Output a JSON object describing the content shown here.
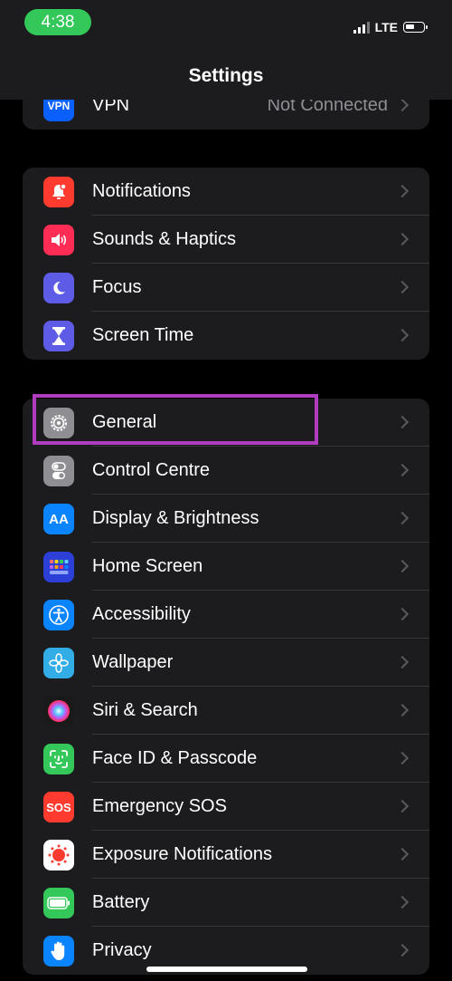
{
  "status_bar": {
    "time": "4:38",
    "network": "LTE"
  },
  "title": "Settings",
  "vpn": {
    "label": "VPN",
    "icon_text": "VPN",
    "value": "Not Connected",
    "icon_color": "#0a60ff"
  },
  "group1": [
    {
      "label": "Notifications",
      "icon": "notifications-icon",
      "color": "#ff3b30"
    },
    {
      "label": "Sounds & Haptics",
      "icon": "speaker-icon",
      "color": "#ff2d55"
    },
    {
      "label": "Focus",
      "icon": "moon-icon",
      "color": "#5e5ce6"
    },
    {
      "label": "Screen Time",
      "icon": "hourglass-icon",
      "color": "#5e5ce6"
    }
  ],
  "group2": [
    {
      "label": "General",
      "icon": "gear-icon",
      "color": "#8e8e93"
    },
    {
      "label": "Control Centre",
      "icon": "toggles-icon",
      "color": "#8e8e93"
    },
    {
      "label": "Display & Brightness",
      "icon": "text-size-icon",
      "icon_text": "AA",
      "color": "#0a84ff"
    },
    {
      "label": "Home Screen",
      "icon": "app-grid-icon",
      "color": "#2c3fd6"
    },
    {
      "label": "Accessibility",
      "icon": "accessibility-icon",
      "color": "#0a84ff"
    },
    {
      "label": "Wallpaper",
      "icon": "flower-icon",
      "color": "#32ade6"
    },
    {
      "label": "Siri & Search",
      "icon": "siri-icon",
      "color": "#222"
    },
    {
      "label": "Face ID & Passcode",
      "icon": "face-id-icon",
      "color": "#34c759"
    },
    {
      "label": "Emergency SOS",
      "icon": "sos-icon",
      "icon_text": "SOS",
      "color": "#ff3b30"
    },
    {
      "label": "Exposure Notifications",
      "icon": "exposure-icon",
      "color": "#ffffff"
    },
    {
      "label": "Battery",
      "icon": "battery-icon",
      "color": "#34c759"
    },
    {
      "label": "Privacy",
      "icon": "hand-icon",
      "color": "#0a84ff"
    }
  ],
  "highlight_color": "#b03cc0"
}
